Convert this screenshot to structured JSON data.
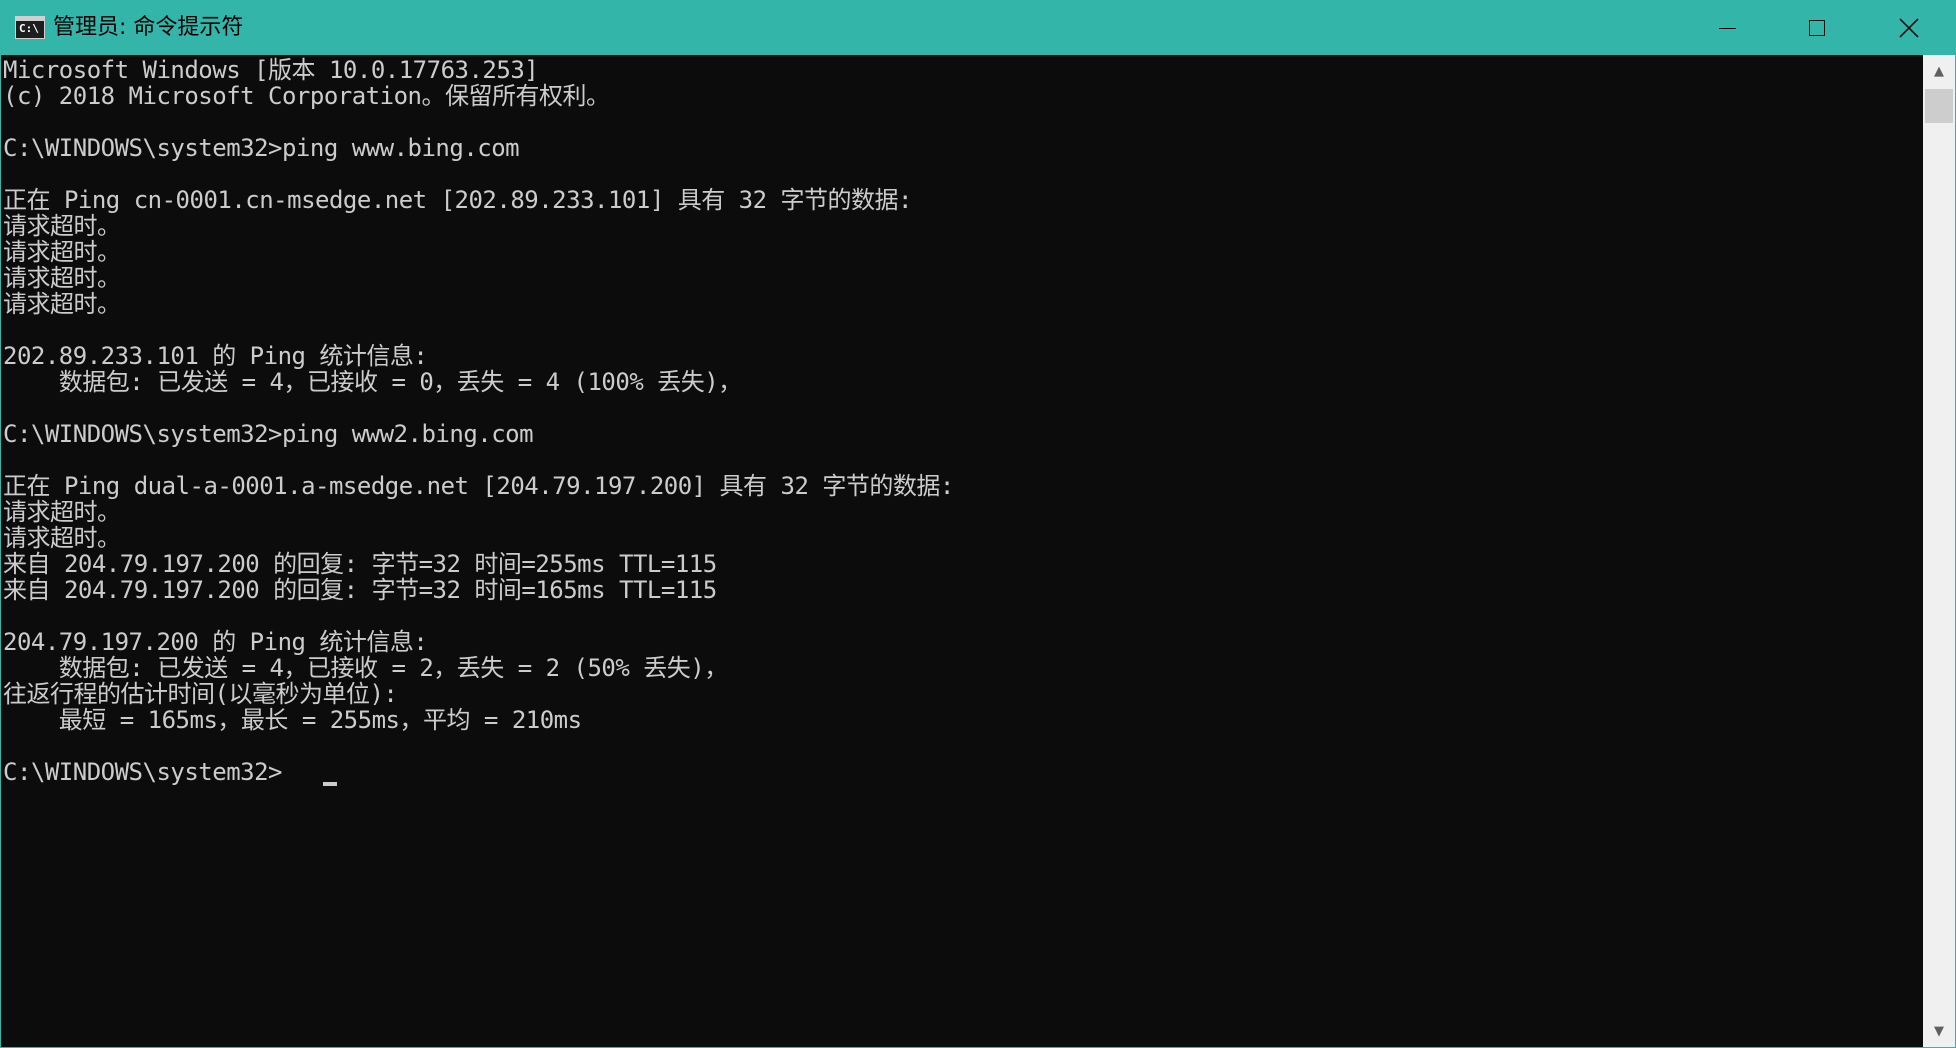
{
  "window": {
    "title": "管理员: 命令提示符",
    "icon_label": "C:\\",
    "accent_color": "#33b5aa",
    "buttons": {
      "minimize": "minimize-icon",
      "maximize": "maximize-icon",
      "close": "close-icon"
    }
  },
  "console": {
    "background": "#0c0c0c",
    "foreground": "#cccccc",
    "lines": [
      "Microsoft Windows [版本 10.0.17763.253]",
      "(c) 2018 Microsoft Corporation。保留所有权利。",
      "",
      "C:\\WINDOWS\\system32>ping www.bing.com",
      "",
      "正在 Ping cn-0001.cn-msedge.net [202.89.233.101] 具有 32 字节的数据:",
      "请求超时。",
      "请求超时。",
      "请求超时。",
      "请求超时。",
      "",
      "202.89.233.101 的 Ping 统计信息:",
      "    数据包: 已发送 = 4，已接收 = 0，丢失 = 4 (100% 丢失)，",
      "",
      "C:\\WINDOWS\\system32>ping www2.bing.com",
      "",
      "正在 Ping dual-a-0001.a-msedge.net [204.79.197.200] 具有 32 字节的数据:",
      "请求超时。",
      "请求超时。",
      "来自 204.79.197.200 的回复: 字节=32 时间=255ms TTL=115",
      "来自 204.79.197.200 的回复: 字节=32 时间=165ms TTL=115",
      "",
      "204.79.197.200 的 Ping 统计信息:",
      "    数据包: 已发送 = 4，已接收 = 2，丢失 = 2 (50% 丢失)，",
      "往返行程的估计时间(以毫秒为单位):",
      "    最短 = 165ms，最长 = 255ms，平均 = 210ms",
      "",
      "C:\\WINDOWS\\system32>"
    ]
  },
  "scrollbar": {
    "up_arrow": "▲",
    "down_arrow": "▼",
    "position_fraction": 0.0
  }
}
